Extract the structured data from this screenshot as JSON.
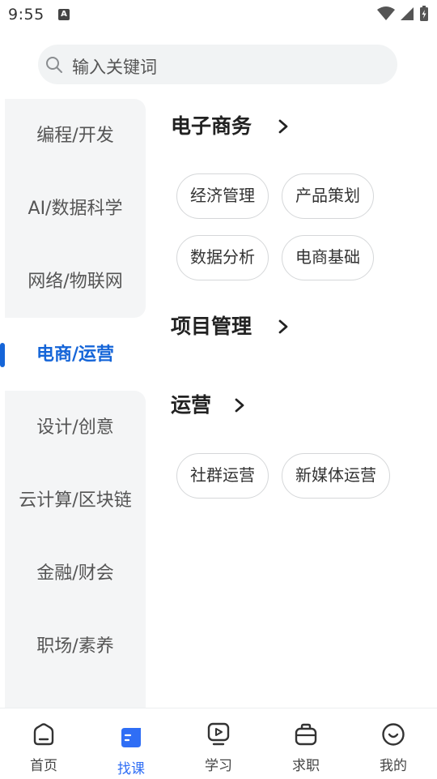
{
  "status_bar": {
    "time": "9:55",
    "notification_letter": "A"
  },
  "search": {
    "placeholder": "输入关键词"
  },
  "categories": [
    {
      "label": "编程/开发",
      "active": false
    },
    {
      "label": "AI/数据科学",
      "active": false
    },
    {
      "label": "网络/物联网",
      "active": false
    },
    {
      "label": "电商/运营",
      "active": true
    },
    {
      "label": "设计/创意",
      "active": false
    },
    {
      "label": "云计算/区块链",
      "active": false
    },
    {
      "label": "金融/财会",
      "active": false
    },
    {
      "label": "职场/素养",
      "active": false
    }
  ],
  "sections": [
    {
      "title": "电子商务",
      "tags": [
        "经济管理",
        "产品策划",
        "数据分析",
        "电商基础"
      ]
    },
    {
      "title": "项目管理",
      "tags": []
    },
    {
      "title": "运营",
      "tags": [
        "社群运营",
        "新媒体运营"
      ]
    }
  ],
  "bottom_nav": [
    {
      "label": "首页",
      "icon": "home-icon",
      "active": false
    },
    {
      "label": "找课",
      "icon": "find-course-icon",
      "active": true
    },
    {
      "label": "学习",
      "icon": "study-icon",
      "active": false
    },
    {
      "label": "求职",
      "icon": "job-icon",
      "active": false
    },
    {
      "label": "我的",
      "icon": "profile-icon",
      "active": false
    }
  ],
  "colors": {
    "accent": "#1565d8",
    "nav_active": "#2f6ef5",
    "panel_bg": "#f4f5f6"
  }
}
